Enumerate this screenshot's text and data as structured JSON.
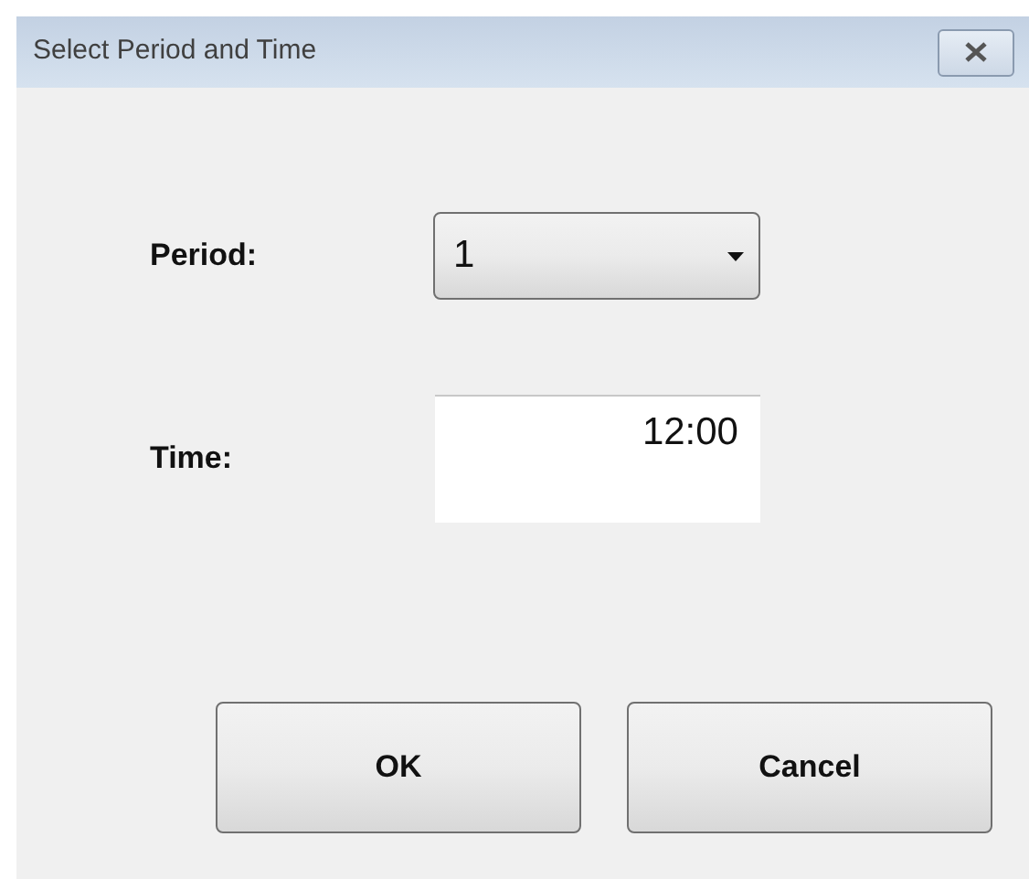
{
  "window": {
    "title": "Select Period and Time"
  },
  "period": {
    "label": "Period:",
    "value": "1"
  },
  "time": {
    "label": "Time:",
    "value": "12:00"
  },
  "buttons": [
    "OK",
    "Cancel"
  ]
}
